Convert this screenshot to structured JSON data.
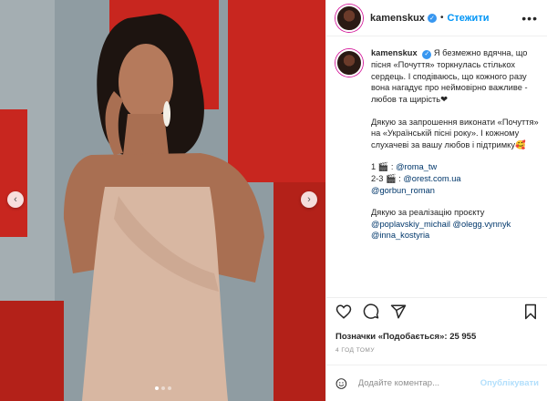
{
  "post": {
    "username": "kamenskux",
    "follow_label": "Стежити",
    "separator": "•",
    "more_label": "•••"
  },
  "caption": {
    "username": "kamenskux",
    "p1": "Я безмежно вдячна, що пісня «Почуття» торкнулась стількох сердець. І сподіваюсь, що кожного разу вона нагадує про неймовірно важливе - любов та щирість❤",
    "p2": "Дякую за запрошення виконати «Почуття» на «Українській пісні року». І кожному слухачеві за вашу любов і підтримку🥰",
    "credit1_prefix": "1 🎬 : ",
    "credit1_tag": "@roma_tw",
    "credit2_prefix": "2-3 🎬 : ",
    "credit2_tag": "@orest.com.ua",
    "credit3_tag": "@gorbun_roman",
    "p4": "Дякую за реалізацію проєкту",
    "tag_a": "@poplavskiy_michail",
    "tag_b": "@olegg.vynnyk",
    "tag_c": "@inna_kostyria"
  },
  "likes": "Позначки «Подобається»: 25 955",
  "time": "4 ГОД ТОМУ",
  "comment": {
    "placeholder": "Додайте коментар...",
    "publish_label": "Опублікувати"
  },
  "carousel": {
    "prev_icon": "‹",
    "next_icon": "›",
    "total": 3,
    "active": 1
  },
  "colors": {
    "wall_red": "#c8261f",
    "wall_gray": "#8c9aa0",
    "dress": "#d8b7a2",
    "link": "#00376b",
    "accent": "#0095f6"
  }
}
